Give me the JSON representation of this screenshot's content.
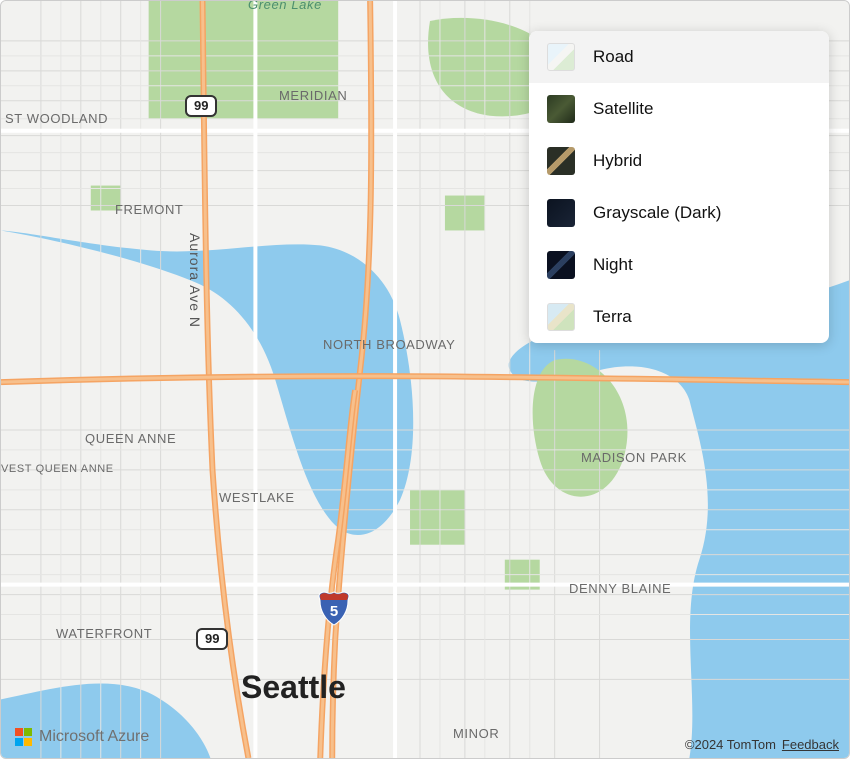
{
  "map": {
    "city_label": "Seattle",
    "neighborhoods": {
      "green_lake": "Green Lake",
      "meridian": "MERIDIAN",
      "woodland": "ST WOODLAND",
      "fremont": "FREMONT",
      "queen_anne": "QUEEN ANNE",
      "west_queen_anne": "VEST QUEEN ANNE",
      "westlake": "WESTLAKE",
      "waterfront": "WATERFRONT",
      "north_broadway": "NORTH BROADWAY",
      "madison_park": "MADISON PARK",
      "denny_blaine": "DENNY BLAINE",
      "minor": "MINOR"
    },
    "streets": {
      "aurora": "Aurora Ave N"
    },
    "shields": {
      "sr99_top": "99",
      "sr99_bottom": "99",
      "i5": "5"
    }
  },
  "style_picker": {
    "items": [
      {
        "key": "road",
        "label": "Road",
        "selected": true
      },
      {
        "key": "satellite",
        "label": "Satellite",
        "selected": false
      },
      {
        "key": "hybrid",
        "label": "Hybrid",
        "selected": false
      },
      {
        "key": "grayscale",
        "label": "Grayscale (Dark)",
        "selected": false
      },
      {
        "key": "night",
        "label": "Night",
        "selected": false
      },
      {
        "key": "terra",
        "label": "Terra",
        "selected": false
      }
    ]
  },
  "attribution": {
    "brand": "Microsoft Azure",
    "copyright": "©2024 TomTom",
    "feedback": "Feedback",
    "logo_colors": {
      "r": "#f25022",
      "g": "#7fba00",
      "b": "#00a4ef",
      "y": "#ffb900"
    }
  }
}
